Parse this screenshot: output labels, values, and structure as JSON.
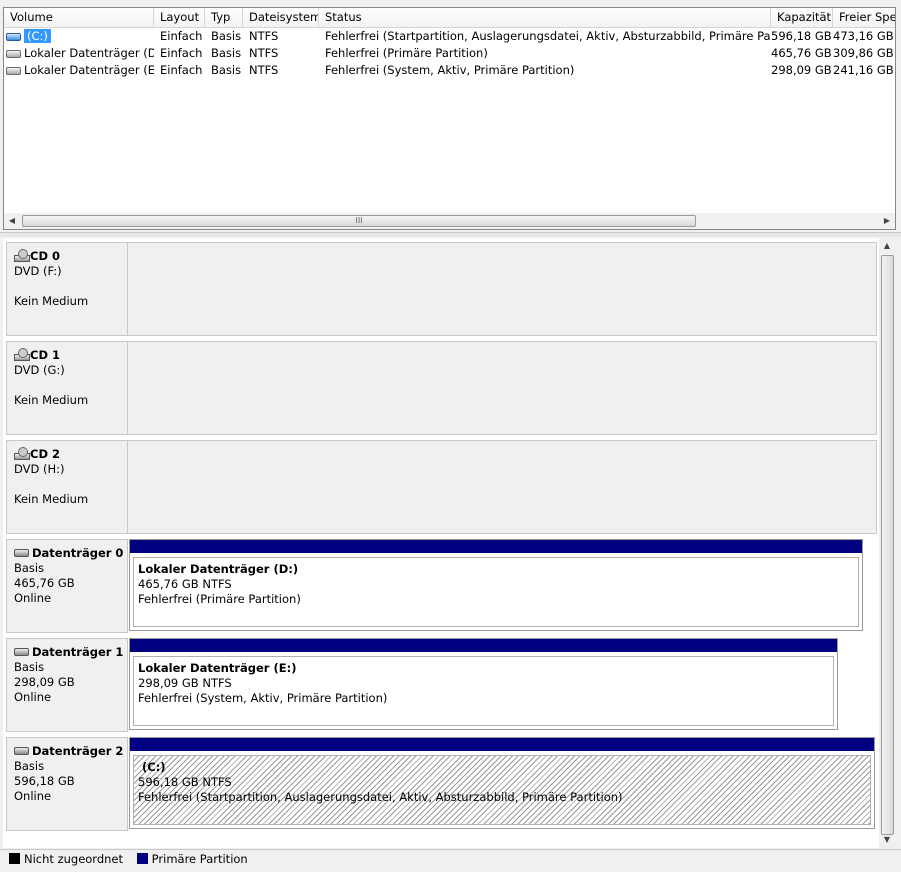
{
  "columns": {
    "volume": "Volume",
    "layout": "Layout",
    "type": "Typ",
    "filesystem": "Dateisystem",
    "status": "Status",
    "capacity": "Kapazität",
    "free": "Freier Spei"
  },
  "volumes": [
    {
      "name": "(C:)",
      "layout": "Einfach",
      "type": "Basis",
      "fs": "NTFS",
      "status": "Fehlerfrei (Startpartition, Auslagerungsdatei, Aktiv, Absturzabbild, Primäre Partition)",
      "capacity": "596,18 GB",
      "free": "473,16 GB",
      "selected": true
    },
    {
      "name": "Lokaler Datenträger (D:)",
      "layout": "Einfach",
      "type": "Basis",
      "fs": "NTFS",
      "status": "Fehlerfrei (Primäre Partition)",
      "capacity": "465,76 GB",
      "free": "309,86 GB"
    },
    {
      "name": "Lokaler Datenträger (E:)",
      "layout": "Einfach",
      "type": "Basis",
      "fs": "NTFS",
      "status": "Fehlerfrei (System, Aktiv, Primäre Partition)",
      "capacity": "298,09 GB",
      "free": "241,16 GB"
    }
  ],
  "scrollbar_grip": "III",
  "disks": [
    {
      "name": "CD 0",
      "line1": "DVD (F:)",
      "line2": "",
      "line3": "Kein Medium"
    },
    {
      "name": "CD 1",
      "line1": "DVD (G:)",
      "line2": "",
      "line3": "Kein Medium"
    },
    {
      "name": "CD 2",
      "line1": "DVD (H:)",
      "line2": "",
      "line3": "Kein Medium"
    },
    {
      "name": "Datenträger 0",
      "line1": "Basis",
      "line2": "465,76 GB",
      "line3": "Online",
      "partition": {
        "name": "Lokaler Datenträger  (D:)",
        "size": "465,76 GB NTFS",
        "status": "Fehlerfrei (Primäre Partition)"
      }
    },
    {
      "name": "Datenträger 1",
      "line1": "Basis",
      "line2": "298,09 GB",
      "line3": "Online",
      "partition": {
        "name": "Lokaler Datenträger  (E:)",
        "size": "298,09 GB NTFS",
        "status": "Fehlerfrei (System, Aktiv, Primäre Partition)"
      }
    },
    {
      "name": "Datenträger 2",
      "line1": "Basis",
      "line2": "596,18 GB",
      "line3": "Online",
      "partition": {
        "name": "(C:)",
        "size": "596,18 GB NTFS",
        "status": "Fehlerfrei (Startpartition, Auslagerungsdatei, Aktiv, Absturzabbild, Primäre Partition)"
      }
    }
  ],
  "legend": [
    {
      "label": "Nicht zugeordnet",
      "color": "#000000"
    },
    {
      "label": "Primäre Partition",
      "color": "#000080"
    }
  ],
  "colors": {
    "primary_partition_bar": "#000080",
    "selection": "#3399ff"
  }
}
